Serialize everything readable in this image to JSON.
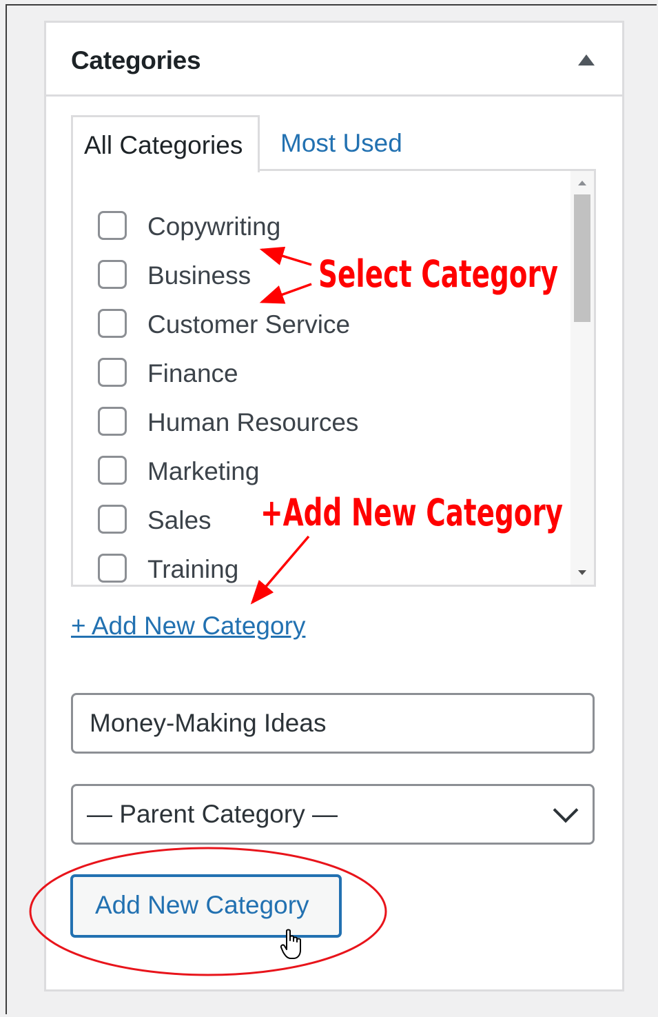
{
  "panel": {
    "title": "Categories"
  },
  "tabs": [
    {
      "label": "All Categories",
      "active": true
    },
    {
      "label": "Most Used",
      "active": false
    }
  ],
  "categories": [
    {
      "label": "Copywriting",
      "checked": false
    },
    {
      "label": "Business",
      "checked": false
    },
    {
      "label": "Customer Service",
      "checked": false
    },
    {
      "label": "Finance",
      "checked": false
    },
    {
      "label": "Human Resources",
      "checked": false
    },
    {
      "label": "Marketing",
      "checked": false
    },
    {
      "label": "Sales",
      "checked": false
    },
    {
      "label": "Training",
      "checked": false
    }
  ],
  "add_link": "+ Add New Category",
  "new_category_input": {
    "value": "Money-Making Ideas"
  },
  "parent_select": {
    "selected": "— Parent Category —"
  },
  "add_button": "Add New Category",
  "annotations": {
    "select_category": "Select Category",
    "add_new_category": "+Add New Category"
  },
  "colors": {
    "accent": "#2271b1",
    "annotation": "#ff0000",
    "border": "#dcdcde"
  },
  "icons": {
    "toggle": "triangle-up-icon",
    "select": "chevron-down-icon",
    "cursor": "hand-pointer-icon"
  }
}
